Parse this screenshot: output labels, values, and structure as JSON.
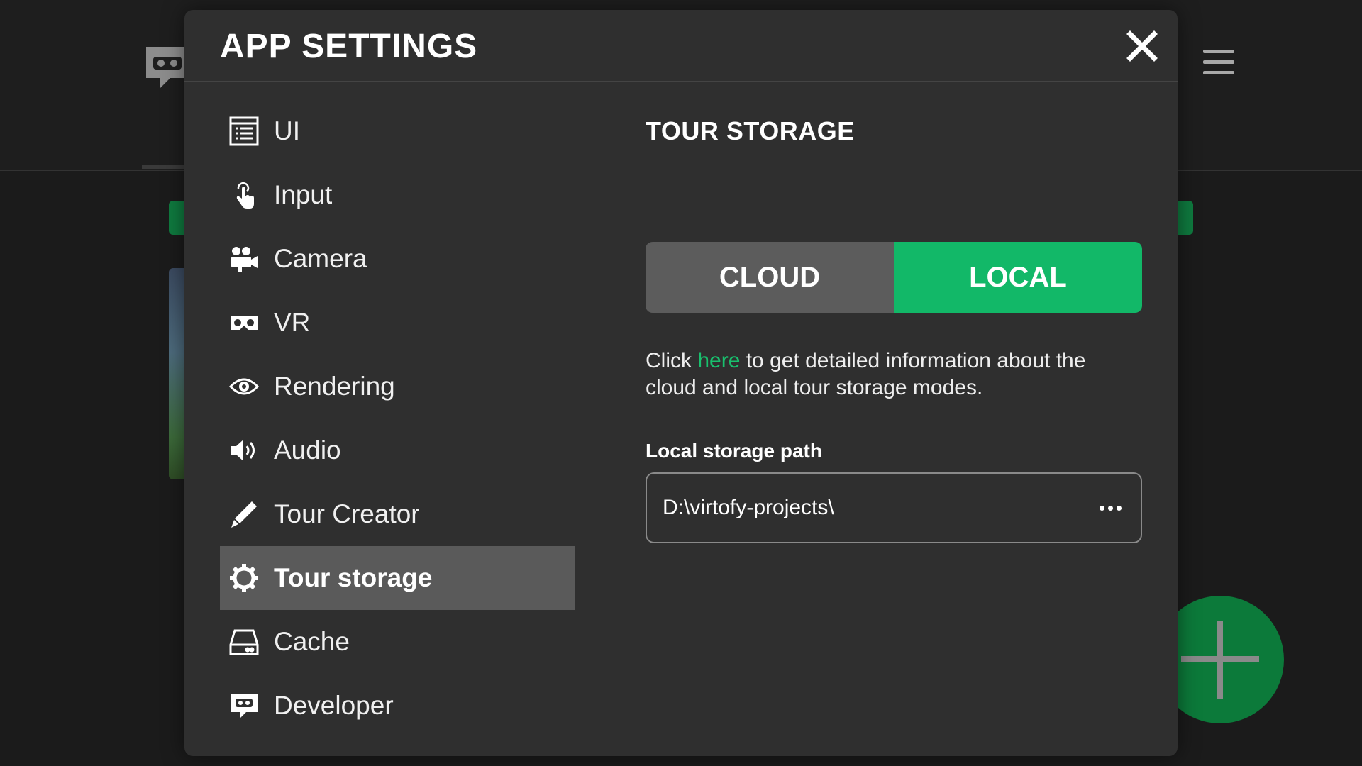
{
  "modal": {
    "title": "APP SETTINGS",
    "close_icon": "close-icon"
  },
  "sidebar": {
    "items": [
      {
        "label": "UI",
        "icon": "list-icon",
        "active": false
      },
      {
        "label": "Input",
        "icon": "touch-icon",
        "active": false
      },
      {
        "label": "Camera",
        "icon": "camera-icon",
        "active": false
      },
      {
        "label": "VR",
        "icon": "vr-headset-icon",
        "active": false
      },
      {
        "label": "Rendering",
        "icon": "eye-icon",
        "active": false
      },
      {
        "label": "Audio",
        "icon": "speaker-icon",
        "active": false
      },
      {
        "label": "Tour Creator",
        "icon": "pencil-icon",
        "active": false
      },
      {
        "label": "Tour storage",
        "icon": "gear-icon",
        "active": true
      },
      {
        "label": "Cache",
        "icon": "drive-icon",
        "active": false
      },
      {
        "label": "Developer",
        "icon": "developer-icon",
        "active": false
      }
    ]
  },
  "content": {
    "section_title": "TOUR STORAGE",
    "toggle": {
      "cloud_label": "CLOUD",
      "local_label": "LOCAL",
      "selected": "LOCAL"
    },
    "info": {
      "prefix": "Click ",
      "link": "here",
      "suffix": " to get detailed information about the cloud and local tour storage modes."
    },
    "path_label": "Local storage path",
    "path_value": "D:\\virtofy-projects\\"
  },
  "colors": {
    "accent": "#12b868",
    "modal_bg": "#2f2f2f",
    "active_item_bg": "#5a5a5a",
    "cloud_bg": "#5c5c5c",
    "link": "#19c06e"
  }
}
